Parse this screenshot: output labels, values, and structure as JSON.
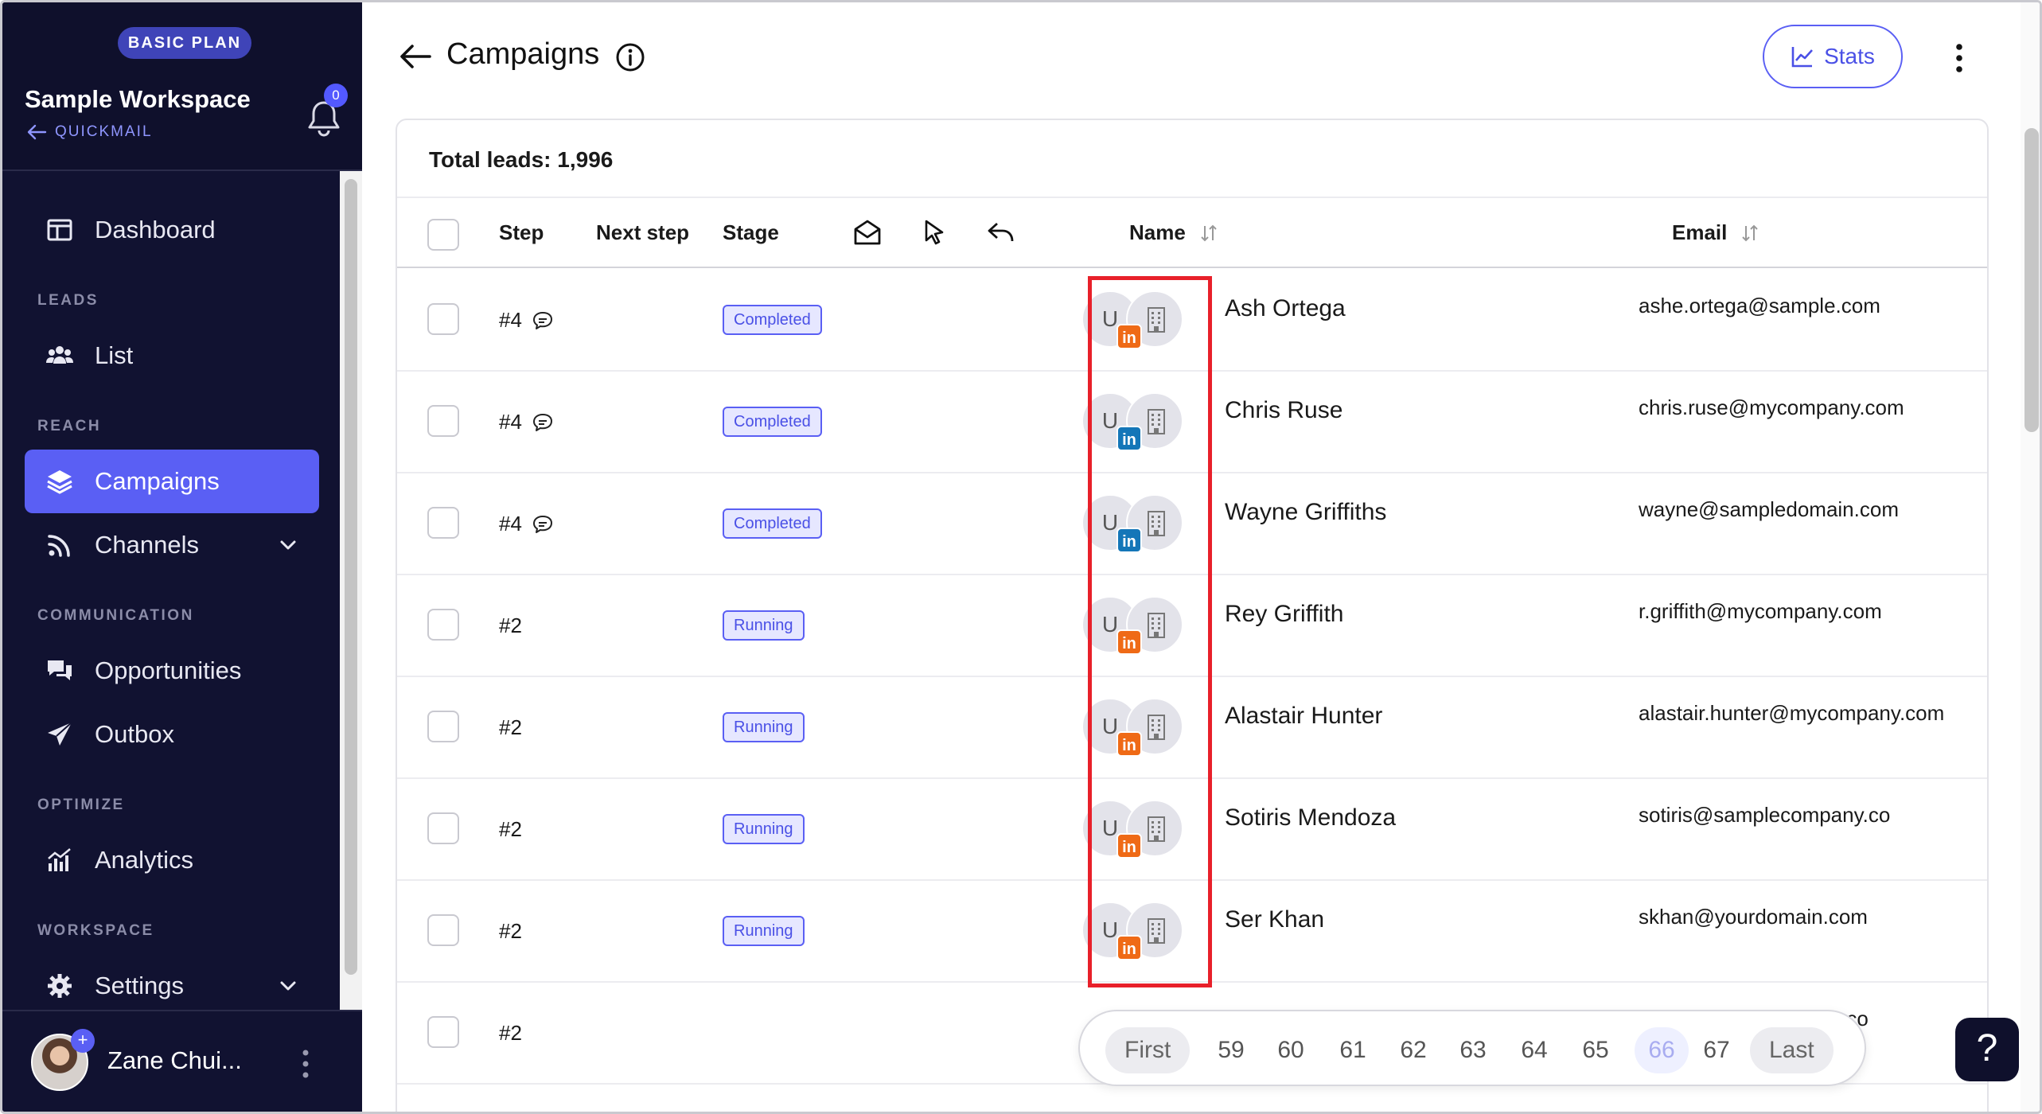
{
  "sidebar": {
    "plan": "BASIC PLAN",
    "workspace": "Sample Workspace",
    "back_label": "QUICKMAIL",
    "notifications": "0",
    "items": [
      {
        "label": "Dashboard",
        "icon": "dashboard-icon"
      },
      {
        "label": "List",
        "icon": "users-icon"
      },
      {
        "label": "Campaigns",
        "icon": "layers-icon",
        "active": true
      },
      {
        "label": "Channels",
        "icon": "rss-icon"
      },
      {
        "label": "Opportunities",
        "icon": "chat-icon"
      },
      {
        "label": "Outbox",
        "icon": "send-icon"
      },
      {
        "label": "Analytics",
        "icon": "analytics-icon"
      },
      {
        "label": "Settings",
        "icon": "gear-icon"
      }
    ],
    "sections": [
      "LEADS",
      "REACH",
      "COMMUNICATION",
      "OPTIMIZE",
      "WORKSPACE"
    ],
    "user": "Zane Chui..."
  },
  "header": {
    "title": "Campaigns",
    "stats_label": "Stats"
  },
  "table": {
    "total": "Total leads: 1,996",
    "columns": {
      "step": "Step",
      "next_step": "Next step",
      "stage": "Stage",
      "name": "Name",
      "email": "Email"
    },
    "rows": [
      {
        "step": "#4",
        "comment": true,
        "stage": "Completed",
        "avatar": "U",
        "li_color": "#ef6a16",
        "name": "Ash Ortega",
        "email": "ashe.ortega@sample.com"
      },
      {
        "step": "#4",
        "comment": true,
        "stage": "Completed",
        "avatar": "U",
        "li_color": "#1476b8",
        "name": "Chris Ruse",
        "email": "chris.ruse@mycompany.com"
      },
      {
        "step": "#4",
        "comment": true,
        "stage": "Completed",
        "avatar": "U",
        "li_color": "#1476b8",
        "name": "Wayne Griffiths",
        "email": "wayne@sampledomain.com"
      },
      {
        "step": "#2",
        "comment": false,
        "stage": "Running",
        "avatar": "U",
        "li_color": "#ef6a16",
        "name": "Rey Griffith",
        "email": "r.griffith@mycompany.com"
      },
      {
        "step": "#2",
        "comment": false,
        "stage": "Running",
        "avatar": "U",
        "li_color": "#ef6a16",
        "name": "Alastair Hunter",
        "email": "alastair.hunter@mycompany.com"
      },
      {
        "step": "#2",
        "comment": false,
        "stage": "Running",
        "avatar": "U",
        "li_color": "#ef6a16",
        "name": "Sotiris Mendoza",
        "email": "sotiris@samplecompany.co"
      },
      {
        "step": "#2",
        "comment": false,
        "stage": "Running",
        "avatar": "U",
        "li_color": "#ef6a16",
        "name": "Ser Khan",
        "email": "skhan@yourdomain.com"
      },
      {
        "step": "#2",
        "comment": false,
        "stage": "",
        "avatar": "",
        "li_color": "",
        "name": "",
        "email": "michael@mycompany.co"
      }
    ],
    "li_label": "in"
  },
  "pagination": {
    "first": "First",
    "pages": [
      "59",
      "60",
      "61",
      "62",
      "63",
      "64",
      "65",
      "66",
      "67"
    ],
    "current": "66",
    "last": "Last"
  },
  "help_label": "?",
  "colors": {
    "accent": "#5a5ff4",
    "sidebar_bg": "#111231",
    "highlight": "#e8202a"
  }
}
